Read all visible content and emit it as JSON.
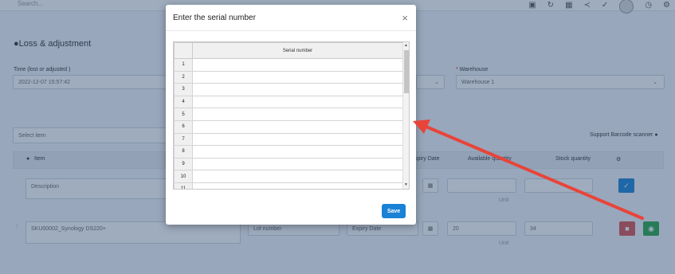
{
  "app": {
    "search_placeholder": "Search...",
    "page_title": "Loss & adjustment",
    "time_label": "Time (lost or adjusted )",
    "time_value": "2022-12-07 15:57:42",
    "warehouse_label": "Warehouse",
    "warehouse_value": "Warehouse 1",
    "select_item_placeholder": "Select item",
    "barcode_label": "Support Barcode scanner",
    "columns": {
      "item": "Item",
      "expiry": "xpiry Date",
      "available": "Available quantity",
      "stock": "Stock quantity"
    },
    "row1": {
      "description_placeholder": "Description",
      "unit": "Unit"
    },
    "row2": {
      "item_value": "SKU00002_Synology DS220+",
      "lot_placeholder": "Lot number",
      "expiry_placeholder": "Expiry Date",
      "available_value": "20",
      "stock_value": "34",
      "unit": "Unit"
    }
  },
  "modal": {
    "title": "Enter the serial number",
    "column_header": "Serial number",
    "rows": [
      "1",
      "2",
      "3",
      "4",
      "5",
      "6",
      "7",
      "8",
      "9",
      "10",
      "11"
    ],
    "save_label": "Save"
  },
  "colors": {
    "primary": "#1a82d6",
    "danger": "#d9534f",
    "success": "#28a745",
    "arrow": "#e8443a"
  }
}
